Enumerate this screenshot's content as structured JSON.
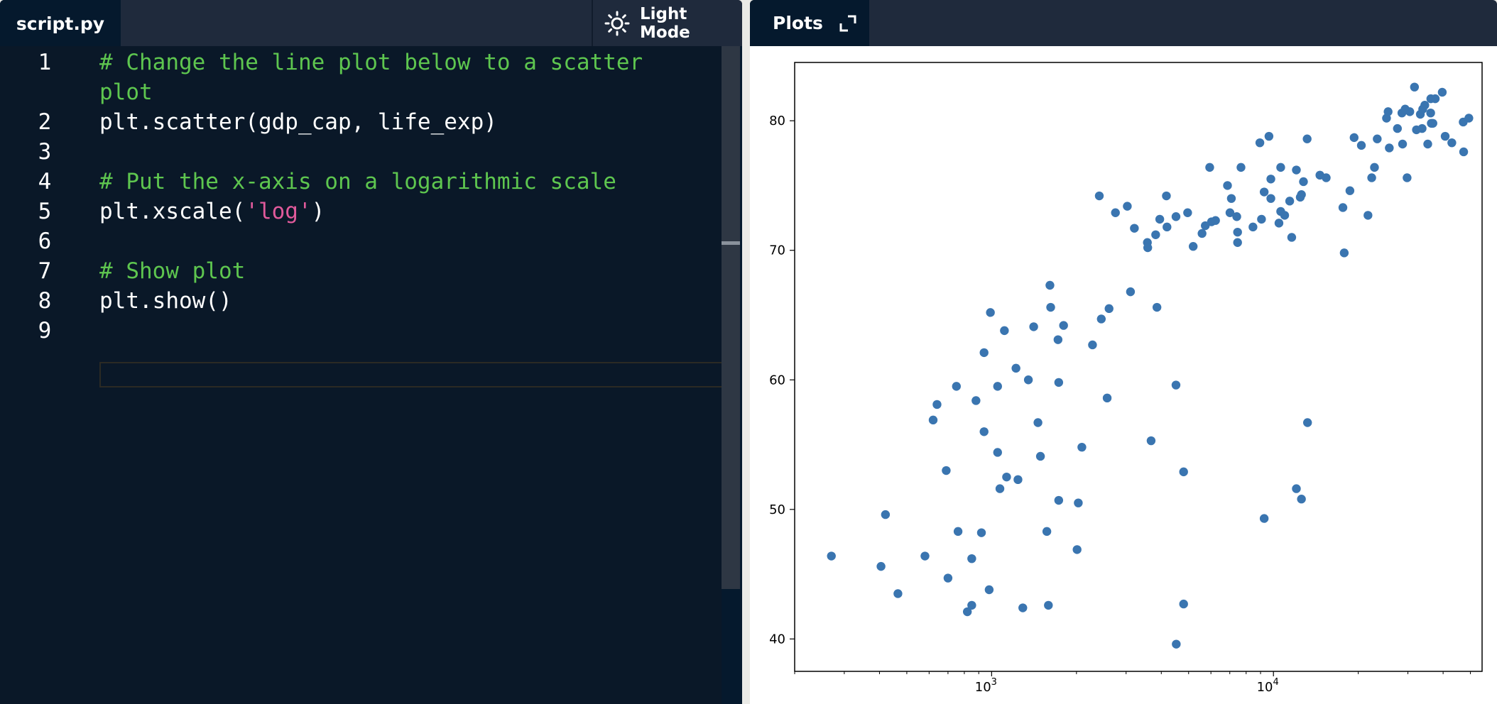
{
  "editor": {
    "file_tab": "script.py",
    "light_mode_label": "Light Mode",
    "light_mode_icon": "sun-icon",
    "lines": [
      {
        "number": "1",
        "tokens": [
          {
            "text": "# Change the line plot below to a scatter",
            "type": "comment"
          }
        ]
      },
      {
        "number": "",
        "tokens": [
          {
            "text": "plot",
            "type": "comment"
          }
        ]
      },
      {
        "number": "2",
        "tokens": [
          {
            "text": "plt.scatter(gdp_cap, life_exp)",
            "type": "default"
          }
        ]
      },
      {
        "number": "3",
        "tokens": []
      },
      {
        "number": "4",
        "tokens": [
          {
            "text": "# Put the x-axis on a logarithmic scale",
            "type": "comment"
          }
        ]
      },
      {
        "number": "5",
        "tokens": [
          {
            "text": "plt.xscale(",
            "type": "default"
          },
          {
            "text": "'log'",
            "type": "string"
          },
          {
            "text": ")",
            "type": "default"
          }
        ]
      },
      {
        "number": "6",
        "tokens": []
      },
      {
        "number": "7",
        "tokens": [
          {
            "text": "# Show plot",
            "type": "comment"
          }
        ]
      },
      {
        "number": "8",
        "tokens": [
          {
            "text": "plt.show()",
            "type": "default"
          }
        ]
      },
      {
        "number": "9",
        "tokens": []
      }
    ],
    "colors": {
      "background": "#05192d",
      "comment": "#5ec64f",
      "string": "#e05a9b",
      "text": "#ffffff"
    }
  },
  "plots": {
    "tab_label": "Plots",
    "expand_icon": "expand-icon"
  },
  "chart_data": {
    "type": "scatter",
    "xscale": "log",
    "xlim": [
      200,
      55000
    ],
    "ylim": [
      37.5,
      84.5
    ],
    "x_ticks": [
      {
        "value": 1000,
        "base": "10",
        "exp": "3"
      },
      {
        "value": 10000,
        "base": "10",
        "exp": "4"
      }
    ],
    "y_ticks": [
      40,
      50,
      60,
      70,
      80
    ],
    "marker_color": "#3a75b0",
    "points": [
      {
        "x": 270,
        "y": 46.4
      },
      {
        "x": 405,
        "y": 45.6
      },
      {
        "x": 420,
        "y": 49.6
      },
      {
        "x": 465,
        "y": 43.5
      },
      {
        "x": 580,
        "y": 46.4
      },
      {
        "x": 620,
        "y": 56.9
      },
      {
        "x": 640,
        "y": 58.1
      },
      {
        "x": 690,
        "y": 53.0
      },
      {
        "x": 700,
        "y": 44.7
      },
      {
        "x": 750,
        "y": 59.5
      },
      {
        "x": 760,
        "y": 48.3
      },
      {
        "x": 820,
        "y": 42.1
      },
      {
        "x": 850,
        "y": 42.6
      },
      {
        "x": 850,
        "y": 46.2
      },
      {
        "x": 880,
        "y": 58.4
      },
      {
        "x": 920,
        "y": 48.2
      },
      {
        "x": 940,
        "y": 62.1
      },
      {
        "x": 940,
        "y": 56.0
      },
      {
        "x": 980,
        "y": 43.8
      },
      {
        "x": 990,
        "y": 65.2
      },
      {
        "x": 1050,
        "y": 59.5
      },
      {
        "x": 1050,
        "y": 54.4
      },
      {
        "x": 1070,
        "y": 51.6
      },
      {
        "x": 1110,
        "y": 63.8
      },
      {
        "x": 1130,
        "y": 52.5
      },
      {
        "x": 1220,
        "y": 60.9
      },
      {
        "x": 1240,
        "y": 52.3
      },
      {
        "x": 1290,
        "y": 42.4
      },
      {
        "x": 1350,
        "y": 60.0
      },
      {
        "x": 1410,
        "y": 64.1
      },
      {
        "x": 1460,
        "y": 56.7
      },
      {
        "x": 1490,
        "y": 54.1
      },
      {
        "x": 1570,
        "y": 48.3
      },
      {
        "x": 1590,
        "y": 42.6
      },
      {
        "x": 1610,
        "y": 67.3
      },
      {
        "x": 1620,
        "y": 65.6
      },
      {
        "x": 1720,
        "y": 63.1
      },
      {
        "x": 1730,
        "y": 59.8
      },
      {
        "x": 1730,
        "y": 50.7
      },
      {
        "x": 1800,
        "y": 64.2
      },
      {
        "x": 2010,
        "y": 46.9
      },
      {
        "x": 2030,
        "y": 50.5
      },
      {
        "x": 2090,
        "y": 54.8
      },
      {
        "x": 2280,
        "y": 62.7
      },
      {
        "x": 2410,
        "y": 74.2
      },
      {
        "x": 2450,
        "y": 64.7
      },
      {
        "x": 2570,
        "y": 58.6
      },
      {
        "x": 2610,
        "y": 65.5
      },
      {
        "x": 2750,
        "y": 72.9
      },
      {
        "x": 3030,
        "y": 73.4
      },
      {
        "x": 3110,
        "y": 66.8
      },
      {
        "x": 3210,
        "y": 71.7
      },
      {
        "x": 3570,
        "y": 70.6
      },
      {
        "x": 3580,
        "y": 70.2
      },
      {
        "x": 3680,
        "y": 55.3
      },
      {
        "x": 3820,
        "y": 71.2
      },
      {
        "x": 3860,
        "y": 65.6
      },
      {
        "x": 3950,
        "y": 72.4
      },
      {
        "x": 4170,
        "y": 74.2
      },
      {
        "x": 4190,
        "y": 71.8
      },
      {
        "x": 4510,
        "y": 72.6
      },
      {
        "x": 4510,
        "y": 59.6
      },
      {
        "x": 4520,
        "y": 39.6
      },
      {
        "x": 4800,
        "y": 52.9
      },
      {
        "x": 4800,
        "y": 42.7
      },
      {
        "x": 4960,
        "y": 72.9
      },
      {
        "x": 5190,
        "y": 70.3
      },
      {
        "x": 5580,
        "y": 71.3
      },
      {
        "x": 5730,
        "y": 71.9
      },
      {
        "x": 5940,
        "y": 76.4
      },
      {
        "x": 6030,
        "y": 72.2
      },
      {
        "x": 6230,
        "y": 72.3
      },
      {
        "x": 6870,
        "y": 75.0
      },
      {
        "x": 7010,
        "y": 72.9
      },
      {
        "x": 7090,
        "y": 74.0
      },
      {
        "x": 7410,
        "y": 72.6
      },
      {
        "x": 7460,
        "y": 71.4
      },
      {
        "x": 7460,
        "y": 70.6
      },
      {
        "x": 7670,
        "y": 76.4
      },
      {
        "x": 8460,
        "y": 71.8
      },
      {
        "x": 8950,
        "y": 78.3
      },
      {
        "x": 9070,
        "y": 72.4
      },
      {
        "x": 9270,
        "y": 74.5
      },
      {
        "x": 9270,
        "y": 49.3
      },
      {
        "x": 9640,
        "y": 78.8
      },
      {
        "x": 9790,
        "y": 75.5
      },
      {
        "x": 9790,
        "y": 74.0
      },
      {
        "x": 10460,
        "y": 72.1
      },
      {
        "x": 10610,
        "y": 73.0
      },
      {
        "x": 10610,
        "y": 76.4
      },
      {
        "x": 10960,
        "y": 72.7
      },
      {
        "x": 11420,
        "y": 73.8
      },
      {
        "x": 11610,
        "y": 71.0
      },
      {
        "x": 12060,
        "y": 76.2
      },
      {
        "x": 12060,
        "y": 51.6
      },
      {
        "x": 12450,
        "y": 74.1
      },
      {
        "x": 12570,
        "y": 74.3
      },
      {
        "x": 12570,
        "y": 50.8
      },
      {
        "x": 12780,
        "y": 75.3
      },
      {
        "x": 13170,
        "y": 78.6
      },
      {
        "x": 13210,
        "y": 56.7
      },
      {
        "x": 14620,
        "y": 75.8
      },
      {
        "x": 15390,
        "y": 75.6
      },
      {
        "x": 17640,
        "y": 73.3
      },
      {
        "x": 17830,
        "y": 69.8
      },
      {
        "x": 18680,
        "y": 74.6
      },
      {
        "x": 19330,
        "y": 78.7
      },
      {
        "x": 20510,
        "y": 78.1
      },
      {
        "x": 21650,
        "y": 72.7
      },
      {
        "x": 22320,
        "y": 75.6
      },
      {
        "x": 22830,
        "y": 76.4
      },
      {
        "x": 23350,
        "y": 78.6
      },
      {
        "x": 25190,
        "y": 80.2
      },
      {
        "x": 25520,
        "y": 80.7
      },
      {
        "x": 25770,
        "y": 77.9
      },
      {
        "x": 27540,
        "y": 79.4
      },
      {
        "x": 28570,
        "y": 80.6
      },
      {
        "x": 28720,
        "y": 78.2
      },
      {
        "x": 29340,
        "y": 80.9
      },
      {
        "x": 29800,
        "y": 75.6
      },
      {
        "x": 30470,
        "y": 80.7
      },
      {
        "x": 31660,
        "y": 82.6
      },
      {
        "x": 32170,
        "y": 79.3
      },
      {
        "x": 33210,
        "y": 80.5
      },
      {
        "x": 33690,
        "y": 79.4
      },
      {
        "x": 33860,
        "y": 80.9
      },
      {
        "x": 34440,
        "y": 81.2
      },
      {
        "x": 35280,
        "y": 78.2
      },
      {
        "x": 36130,
        "y": 80.6
      },
      {
        "x": 36180,
        "y": 81.7
      },
      {
        "x": 36320,
        "y": 79.8
      },
      {
        "x": 36800,
        "y": 79.8
      },
      {
        "x": 37510,
        "y": 81.7
      },
      {
        "x": 39720,
        "y": 82.2
      },
      {
        "x": 40680,
        "y": 78.8
      },
      {
        "x": 42950,
        "y": 78.3
      },
      {
        "x": 47140,
        "y": 79.9
      },
      {
        "x": 47310,
        "y": 77.6
      },
      {
        "x": 49360,
        "y": 80.2
      }
    ]
  }
}
